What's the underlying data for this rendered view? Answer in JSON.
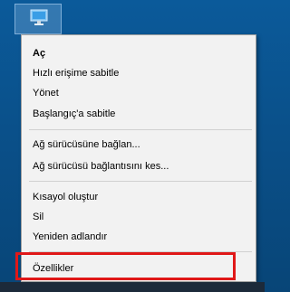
{
  "context_menu": {
    "items": [
      {
        "label": "Aç"
      },
      {
        "label": "Hızlı erişime sabitle"
      },
      {
        "label": "Yönet"
      },
      {
        "label": "Başlangıç'a sabitle"
      },
      {
        "label": "Ağ sürücüsüne bağlan..."
      },
      {
        "label": "Ağ sürücüsü bağlantısını kes..."
      },
      {
        "label": "Kısayol oluştur"
      },
      {
        "label": "Sil"
      },
      {
        "label": "Yeniden adlandır"
      },
      {
        "label": "Özellikler"
      }
    ]
  },
  "icons": {
    "desktop_icon": "this-pc-icon"
  },
  "colors": {
    "desktop_bg": "#0a4f88",
    "menu_bg": "#f2f2f2",
    "highlight_border": "#e01818"
  }
}
